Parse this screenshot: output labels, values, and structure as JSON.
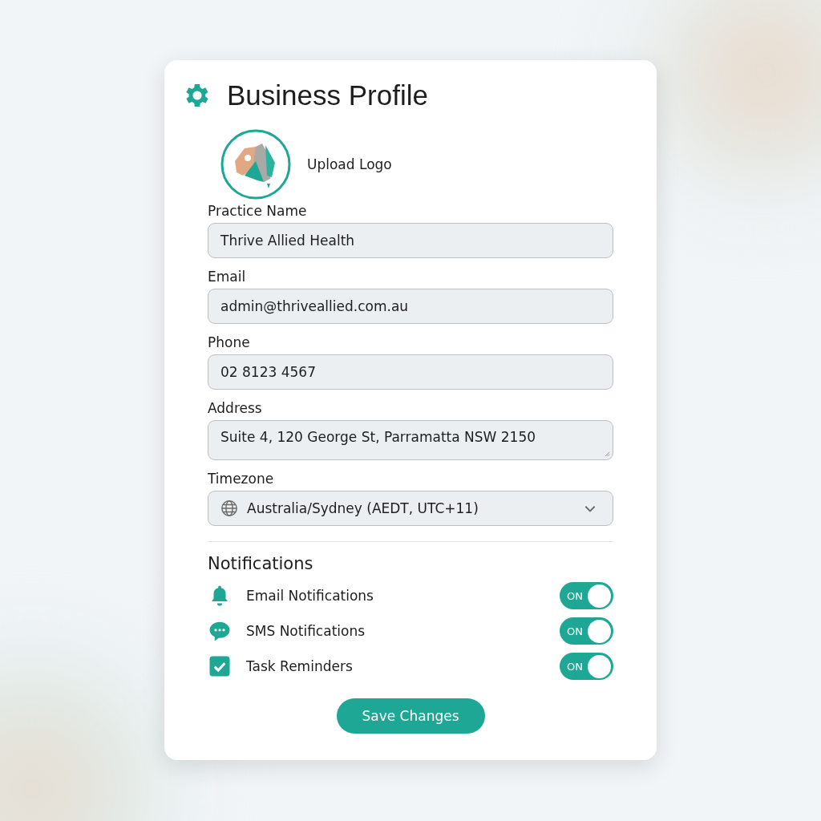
{
  "card": {
    "title": "Business Profile",
    "logo": {
      "label": "Upload Logo"
    },
    "fields": [
      {
        "label": "Practice Name",
        "kind": "input",
        "value": "Thrive Allied Health"
      },
      {
        "label": "Email",
        "kind": "input",
        "value": "admin@thriveallied.com.au"
      },
      {
        "label": "Phone",
        "kind": "input",
        "value": "02 8123 4567"
      },
      {
        "label": "Address",
        "kind": "textarea",
        "value": "Suite 4, 120 George St, Parramatta NSW 2150"
      },
      {
        "label": "Timezone",
        "kind": "select",
        "value": "Australia/Sydney (AEDT, UTC+11)"
      }
    ],
    "notifications": {
      "title": "Notifications",
      "items": [
        {
          "label": "Email Notifications",
          "kind": "bell",
          "on": true,
          "toggle_text": "ON"
        },
        {
          "label": "SMS Notifications",
          "kind": "chat",
          "on": true,
          "toggle_text": "ON"
        },
        {
          "label": "Task Reminders",
          "kind": "check",
          "on": true,
          "toggle_text": "ON"
        }
      ]
    },
    "save_button": "Save Changes"
  }
}
